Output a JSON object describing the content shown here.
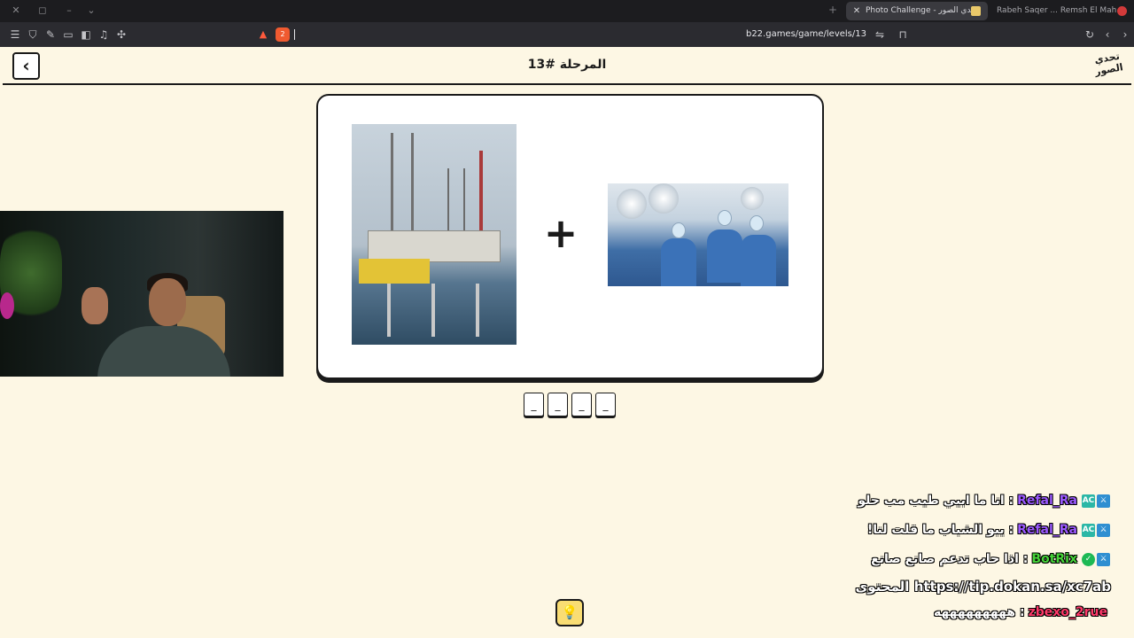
{
  "browser": {
    "tabs": [
      {
        "title": "Photo Challenge - تحدي الصور",
        "active": true
      },
      {
        "title": "Rabeh Saqer ... Remsh El Maha | المها",
        "active": false
      }
    ],
    "url": "b22.games/game/levels/13",
    "shield_count": "2"
  },
  "header": {
    "title": "المرحلة #13",
    "back_icon": "chevron-left-icon",
    "logo_text": "تحدي الصور"
  },
  "puzzle": {
    "image_left": "oil rig at sea",
    "operator": "+",
    "image_right": "surgeons in operating room",
    "answer_slots": [
      "_",
      "_",
      "_",
      "_"
    ]
  },
  "hint": {
    "icon": "lightbulb-icon",
    "glyph": "💡"
  },
  "chat": {
    "messages": [
      {
        "user": "Refal_Ra",
        "text": "انا ما ابيي طيب مب حلو",
        "user_color": "#9b59ff"
      },
      {
        "user": "Refal_Ra",
        "text": "يبو الشباب ما قلت لنا!",
        "user_color": "#9b59ff"
      },
      {
        "user": "BotRix",
        "text": "اذا حاب تدعم صانع صانع",
        "user_color": "#46d43a"
      },
      {
        "user": "zbexo_2rue",
        "text": "هههههههههه",
        "user_color": "#ff3a6a"
      }
    ],
    "link_text": "https://tip.dokan.sa/xc7ab",
    "link_suffix": "المحتوى"
  },
  "colors": {
    "page_bg": "#fdf7e4",
    "border": "#1a1a1a",
    "hint_bg": "#f9dd73",
    "tab_active_bg": "#3a3a3f",
    "toolbar_bg": "#2b2b30"
  }
}
